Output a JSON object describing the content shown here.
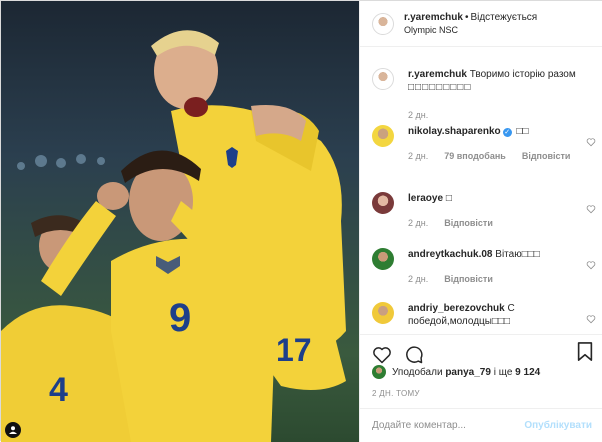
{
  "post": {
    "author": "r.yaremchuk",
    "follow_state": "Відстежується",
    "location": "Olympic NSC"
  },
  "comments": [
    {
      "user": "r.yaremchuk",
      "text": "Творимо історію разом",
      "emoji": "□□□□□□□□□",
      "time": "2 дн."
    },
    {
      "user": "nikolay.shaparenko",
      "verified": true,
      "text": "□□",
      "time": "2 дн.",
      "likes": "79 вподобань",
      "reply": "Відповісти"
    },
    {
      "user": "leraoye",
      "text": "□",
      "time": "2 дн.",
      "reply": "Відповісти"
    },
    {
      "user": "andreytkachuk.08",
      "text": "Вітаю□□□",
      "time": "2 дн.",
      "reply": "Відповісти"
    },
    {
      "user": "andriy_berezovchuk",
      "text": "С победой,молодцы□□□",
      "time": "2 дн.",
      "reply": "Відповісти"
    }
  ],
  "likes": {
    "prefix": "Уподобали",
    "user": "panya_79",
    "conj": "і ще",
    "count": "9 124"
  },
  "posted_ago": "2 ДН. ТОМУ",
  "comment_box": {
    "placeholder": "Додайте коментар...",
    "publish_label": "Опублікувати"
  },
  "photo": {
    "jersey_numbers": [
      "9",
      "17",
      "4"
    ]
  },
  "colors": {
    "link_blue": "#3897f0",
    "publish_disabled": "#b2dffc",
    "jersey_yellow": "#f3d23a"
  }
}
